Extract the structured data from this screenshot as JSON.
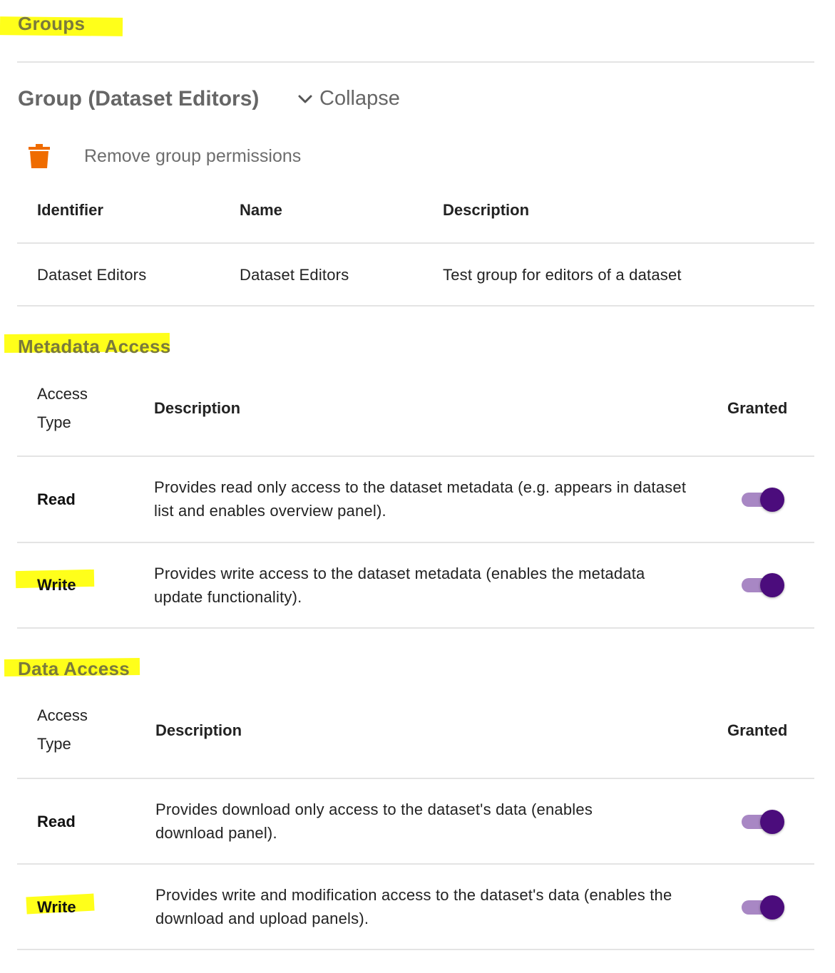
{
  "groups_heading": "Groups",
  "group": {
    "title": "Group (Dataset Editors)",
    "collapse_label": "Collapse",
    "collapse_icon": "chevron-down-icon",
    "remove_label": "Remove group permissions",
    "remove_icon": "trash-icon",
    "remove_icon_color": "#ef6c00",
    "table": {
      "headers": [
        "Identifier",
        "Name",
        "Description"
      ],
      "row": [
        "Dataset Editors",
        "Dataset Editors",
        "Test group for editors of a dataset"
      ]
    }
  },
  "metadata_access": {
    "heading": "Metadata Access",
    "headers": {
      "access_type_line1": "Access",
      "access_type_line2": "Type",
      "description": "Description",
      "granted": "Granted"
    },
    "rows": [
      {
        "type": "Read",
        "description": "Provides read only access to the dataset metadata (e.g. appears in dataset list and enables overview panel).",
        "granted": true
      },
      {
        "type": "Write",
        "description": "Provides write access to the dataset metadata (enables the metadata update functionality).",
        "granted": true
      }
    ]
  },
  "data_access": {
    "heading": "Data Access",
    "headers": {
      "access_type_line1": "Access",
      "access_type_line2": "Type",
      "description": "Description",
      "granted": "Granted"
    },
    "rows": [
      {
        "type": "Read",
        "description": "Provides download only access to the dataset's data (enables download panel).",
        "granted": true
      },
      {
        "type": "Write",
        "description": "Provides write and modification access to the dataset's data (enables the download and upload panels).",
        "granted": true
      }
    ]
  },
  "colors": {
    "highlight": "#ffff1a",
    "toggle_track": "#a887c4",
    "toggle_thumb": "#4b0c7c"
  }
}
